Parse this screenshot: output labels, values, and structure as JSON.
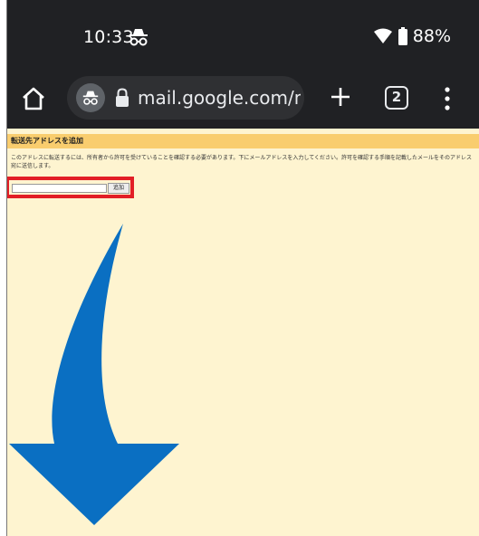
{
  "status_bar": {
    "time": "10:33",
    "battery": "88%"
  },
  "browser": {
    "url": "mail.google.com/mail",
    "tab_count": "2"
  },
  "page": {
    "title": "転送先アドレスを追加",
    "description": "このアドレスに転送するには、所有者から許可を受けていることを確認する必要があります。下にメールアドレスを入力してください。許可を確認する手順を記載したメールをそのアドレス宛に送信します。",
    "email_input_value": "",
    "add_button_label": "追加"
  },
  "colors": {
    "browser_chrome": "#202124",
    "page_background": "#fef4d0",
    "header_background": "#f9cd6e",
    "highlight_border": "#e21e26",
    "arrow": "#0a6fc2"
  }
}
